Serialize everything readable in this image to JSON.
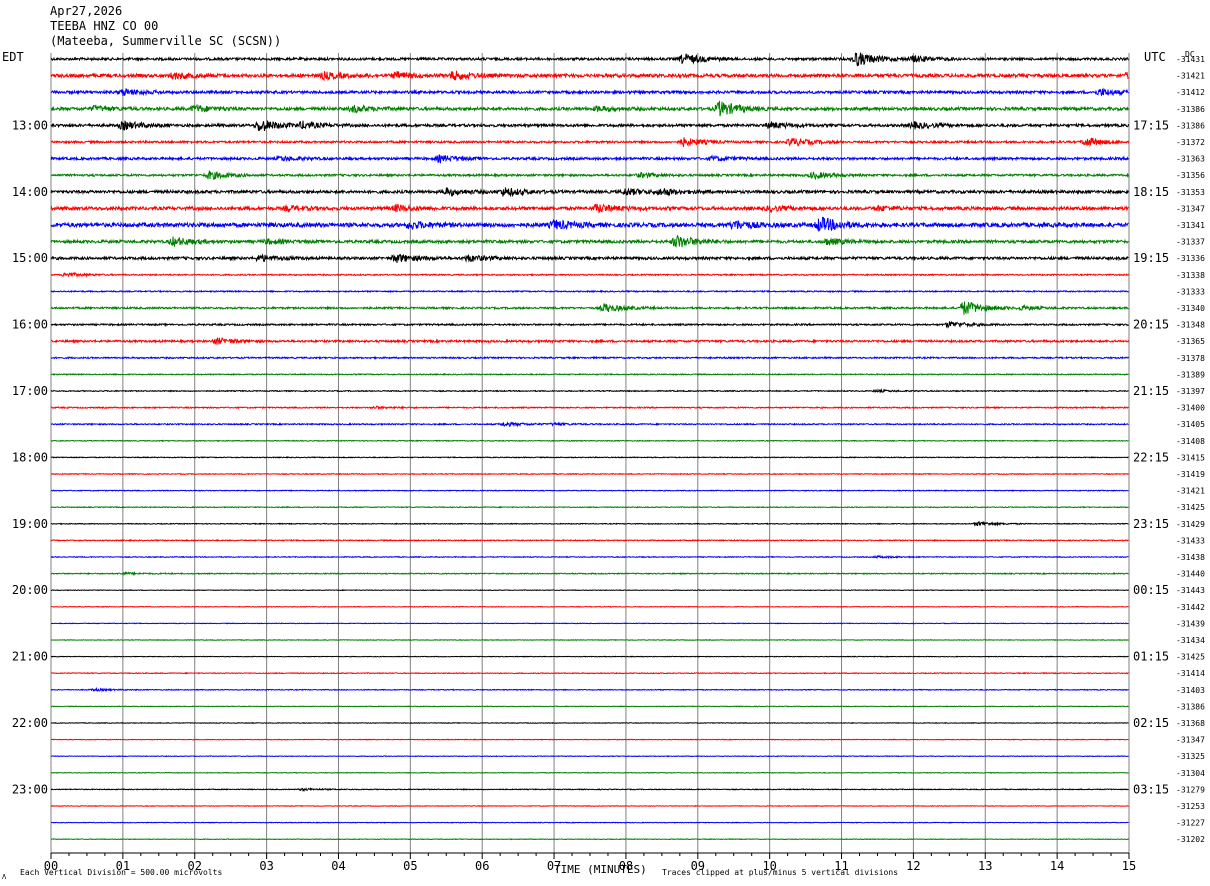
{
  "header": {
    "date": "Apr27,2026",
    "station": "TEEBA HNZ CO 00",
    "location": "(Mateeba, Summerville SC (SCSN))"
  },
  "labels": {
    "left_tz": "EDT",
    "right_tz": "UTC",
    "dc_header": "DC"
  },
  "footer": {
    "scale_note": "Each Vertical Division =  500.00 microvolts",
    "xlabel": "TIME (MINUTES)",
    "clip_note": "Traces clipped at plus/minus 5 vertical divisions",
    "corner_mark": "Λ"
  },
  "colors": {
    "trace_cycle": [
      "#000000",
      "#ff0000",
      "#0000ff",
      "#008000"
    ],
    "grid": "#808080",
    "background": "#ffffff"
  },
  "chart_data": {
    "type": "line",
    "title": "TEEBA HNZ CO 00",
    "xlabel": "TIME (MINUTES)",
    "ylabel": "",
    "xlim": [
      0,
      15
    ],
    "x_ticks": [
      "00",
      "01",
      "02",
      "03",
      "04",
      "05",
      "06",
      "07",
      "08",
      "09",
      "10",
      "11",
      "12",
      "13",
      "14",
      "15"
    ],
    "left_hour_labels": [
      "13:00",
      "14:00",
      "15:00",
      "16:00",
      "17:00",
      "18:00",
      "19:00",
      "20:00",
      "21:00",
      "22:00",
      "23:00"
    ],
    "right_hour_labels": [
      "17:15",
      "18:15",
      "19:15",
      "20:15",
      "21:15",
      "22:15",
      "23:15",
      "00:15",
      "01:15",
      "02:15",
      "03:15"
    ],
    "traces_per_hour": 4,
    "minutes_per_trace": 15,
    "dc_offsets": [
      -31431,
      -31421,
      -31412,
      -31386,
      -31386,
      -31372,
      -31363,
      -31356,
      -31353,
      -31347,
      -31341,
      -31337,
      -31336,
      -31338,
      -31333,
      -31340,
      -31348,
      -31365,
      -31378,
      -31389,
      -31397,
      -31400,
      -31405,
      -31408,
      -31415,
      -31419,
      -31421,
      -31425,
      -31429,
      -31433,
      -31438,
      -31440,
      -31443,
      -31442,
      -31439,
      -31434,
      -31425,
      -31414,
      -31403,
      -31386,
      -31368,
      -31347,
      -31325,
      -31304,
      -31279,
      -31253,
      -31227,
      -31202
    ],
    "activity": [
      {
        "noise": 1.2,
        "end": 15,
        "events": [
          [
            8.8,
            5
          ],
          [
            11.2,
            7
          ],
          [
            12.0,
            3
          ]
        ]
      },
      {
        "noise": 1.6,
        "end": 15,
        "events": [
          [
            1.7,
            3
          ],
          [
            3.8,
            3
          ],
          [
            4.8,
            3
          ],
          [
            5.6,
            4
          ],
          [
            15.0,
            3
          ]
        ]
      },
      {
        "noise": 1.3,
        "end": 15,
        "events": [
          [
            1.0,
            3
          ],
          [
            14.6,
            3
          ]
        ]
      },
      {
        "noise": 1.5,
        "end": 15,
        "events": [
          [
            0.6,
            2
          ],
          [
            2.0,
            3
          ],
          [
            4.2,
            3
          ],
          [
            7.6,
            2
          ],
          [
            9.3,
            7
          ]
        ]
      },
      {
        "noise": 1.3,
        "end": 15,
        "events": [
          [
            1.0,
            4
          ],
          [
            2.9,
            6
          ],
          [
            3.5,
            3
          ],
          [
            10.0,
            3
          ],
          [
            12.0,
            3
          ]
        ]
      },
      {
        "noise": 1.0,
        "end": 15,
        "events": [
          [
            8.8,
            4
          ],
          [
            10.3,
            4
          ],
          [
            14.4,
            4
          ]
        ]
      },
      {
        "noise": 1.2,
        "end": 15,
        "events": [
          [
            3.2,
            2
          ],
          [
            5.4,
            3
          ],
          [
            9.2,
            2
          ]
        ]
      },
      {
        "noise": 1.0,
        "end": 15,
        "events": [
          [
            2.2,
            4
          ],
          [
            8.2,
            2
          ],
          [
            10.6,
            3
          ]
        ]
      },
      {
        "noise": 1.4,
        "end": 15,
        "events": [
          [
            5.5,
            3
          ],
          [
            6.3,
            4
          ],
          [
            8.0,
            3
          ],
          [
            8.5,
            3
          ]
        ]
      },
      {
        "noise": 1.6,
        "end": 15,
        "events": [
          [
            3.3,
            2
          ],
          [
            4.8,
            3
          ],
          [
            7.6,
            4
          ],
          [
            10.0,
            2
          ],
          [
            11.5,
            2
          ]
        ]
      },
      {
        "noise": 2.0,
        "end": 15,
        "events": [
          [
            5.0,
            3
          ],
          [
            7.0,
            4
          ],
          [
            9.5,
            4
          ],
          [
            10.7,
            7
          ]
        ]
      },
      {
        "noise": 1.4,
        "end": 15,
        "events": [
          [
            1.7,
            4
          ],
          [
            3.0,
            2
          ],
          [
            8.7,
            6
          ],
          [
            10.8,
            3
          ]
        ]
      },
      {
        "noise": 1.3,
        "end": 15,
        "events": [
          [
            4.8,
            4
          ],
          [
            5.8,
            3
          ],
          [
            2.9,
            3
          ]
        ]
      },
      {
        "noise": 0.6,
        "end": 15,
        "events": [
          [
            0.2,
            2
          ]
        ]
      },
      {
        "noise": 0.6,
        "end": 15,
        "events": []
      },
      {
        "noise": 0.9,
        "end": 15,
        "events": [
          [
            7.7,
            4
          ],
          [
            12.7,
            7
          ],
          [
            13.5,
            2
          ]
        ]
      },
      {
        "noise": 0.8,
        "end": 15,
        "events": [
          [
            12.5,
            3
          ]
        ]
      },
      {
        "noise": 1.0,
        "end": 15,
        "events": [
          [
            2.3,
            3
          ]
        ]
      },
      {
        "noise": 0.7,
        "end": 15,
        "events": []
      },
      {
        "noise": 0.5,
        "end": 15,
        "events": []
      },
      {
        "noise": 0.5,
        "end": 15,
        "events": [
          [
            11.5,
            1
          ]
        ]
      },
      {
        "noise": 0.6,
        "end": 15,
        "events": [
          [
            4.5,
            1
          ]
        ]
      },
      {
        "noise": 0.6,
        "end": 15,
        "events": [
          [
            6.3,
            2
          ],
          [
            7.0,
            1
          ]
        ]
      },
      {
        "noise": 0.4,
        "end": 15,
        "events": []
      },
      {
        "noise": 0.4,
        "end": 15,
        "events": []
      },
      {
        "noise": 0.4,
        "end": 15,
        "events": []
      },
      {
        "noise": 0.4,
        "end": 15,
        "events": []
      },
      {
        "noise": 0.4,
        "end": 15,
        "events": []
      },
      {
        "noise": 0.4,
        "end": 15,
        "events": [
          [
            12.9,
            2
          ]
        ]
      },
      {
        "noise": 0.5,
        "end": 15,
        "events": []
      },
      {
        "noise": 0.4,
        "end": 15,
        "events": [
          [
            11.5,
            1
          ]
        ]
      },
      {
        "noise": 0.5,
        "end": 15,
        "events": [
          [
            1.0,
            1
          ]
        ]
      },
      {
        "noise": 0.3,
        "end": 15,
        "events": []
      },
      {
        "noise": 0.3,
        "end": 15,
        "events": []
      },
      {
        "noise": 0.3,
        "end": 15,
        "events": []
      },
      {
        "noise": 0.3,
        "end": 15,
        "events": []
      },
      {
        "noise": 0.3,
        "end": 15,
        "events": []
      },
      {
        "noise": 0.4,
        "end": 15,
        "events": []
      },
      {
        "noise": 0.4,
        "end": 15,
        "events": [
          [
            0.6,
            1
          ]
        ]
      },
      {
        "noise": 0.3,
        "end": 15,
        "events": []
      },
      {
        "noise": 0.3,
        "end": 15,
        "events": []
      },
      {
        "noise": 0.3,
        "end": 15,
        "events": []
      },
      {
        "noise": 0.3,
        "end": 15,
        "events": []
      },
      {
        "noise": 0.3,
        "end": 15,
        "events": []
      },
      {
        "noise": 0.4,
        "end": 15,
        "events": [
          [
            3.5,
            1
          ]
        ]
      },
      {
        "noise": 0.3,
        "end": 15,
        "events": []
      },
      {
        "noise": 0.3,
        "end": 15,
        "events": []
      },
      {
        "noise": 0.3,
        "end": 15,
        "events": []
      }
    ]
  }
}
